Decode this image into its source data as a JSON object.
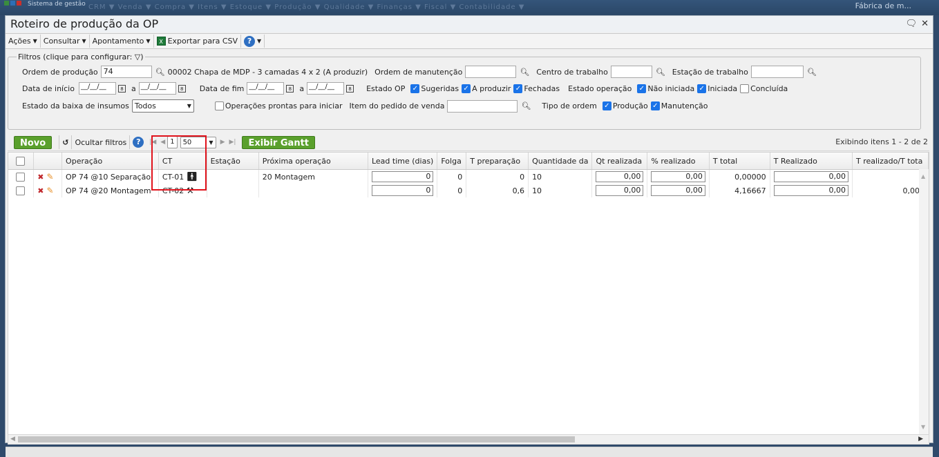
{
  "appbar": {
    "brand": "Sistema de gestão",
    "menu": "CRM ▼  Venda ▼  Compra ▼  Itens ▼  Estoque ▼  Produção ▼  Qualidade ▼  Finanças ▼  Fiscal ▼  Contabilidade ▼",
    "company": "Fábrica de m..."
  },
  "window": {
    "title": "Roteiro de produção da OP"
  },
  "toolbar": {
    "acoes": "Ações",
    "consultar": "Consultar",
    "apontamento": "Apontamento",
    "exportar": "Exportar para CSV",
    "help": "?"
  },
  "filters": {
    "legend": "Filtros (clique para configurar:",
    "ordem_producao_label": "Ordem de produção",
    "ordem_producao_value": "74",
    "ordem_producao_desc": "00002 Chapa de MDP - 3 camadas 4 x 2 (A produzir)",
    "ordem_manutencao_label": "Ordem de manutenção",
    "centro_trabalho_label": "Centro de trabalho",
    "estacao_trabalho_label": "Estação de trabalho",
    "data_inicio_label": "Data de início",
    "date_placeholder": "__/__/__",
    "a_label": "a",
    "data_fim_label": "Data de fim",
    "estado_op_label": "Estado OP",
    "sugeridas": "Sugeridas",
    "a_produzir": "A produzir",
    "fechadas": "Fechadas",
    "estado_operacao_label": "Estado operação",
    "nao_iniciada": "Não iniciada",
    "iniciada": "Iniciada",
    "concluida": "Concluída",
    "estado_baixa_label": "Estado da baixa de insumos",
    "estado_baixa_value": "Todos",
    "operacoes_prontas": "Operações prontas para iniciar",
    "item_pedido_label": "Item do pedido de venda",
    "tipo_ordem_label": "Tipo de ordem",
    "producao": "Produção",
    "manutencao": "Manutenção"
  },
  "gridbar": {
    "novo": "Novo",
    "ocultar_filtros": "Ocultar filtros",
    "help": "?",
    "page": "1",
    "page_size": "50",
    "exibir_gantt": "Exibir Gantt",
    "showing": "Exibindo itens 1 - 2 de 2"
  },
  "columns": {
    "operacao": "Operação",
    "ct": "CT",
    "estacao": "Estação",
    "proxima": "Próxima operação",
    "lead_time": "Lead time (dias)",
    "folga": "Folga",
    "t_preparacao": "T preparação",
    "quantidade": "Quantidade da",
    "qt_realizada": "Qt realizada",
    "pct_realizado": "% realizado",
    "t_total": "T total",
    "t_realizado": "T Realizado",
    "t_realizado_total": "T realizado/T tota"
  },
  "rows": [
    {
      "operacao": "OP 74 @10 Separação",
      "ct": "CT-01",
      "ct_icon": "person-icon",
      "estacao": "",
      "proxima": "20 Montagem",
      "lead_time": "0",
      "folga": "0",
      "t_preparacao": "0",
      "quantidade": "10",
      "qt_realizada": "0,00",
      "pct_realizado": "0,00",
      "t_total": "0,00000",
      "t_realizado": "0,00",
      "t_realizado_total": ""
    },
    {
      "operacao": "OP 74 @20 Montagem",
      "ct": "CT-02",
      "ct_icon": "machine-icon",
      "estacao": "",
      "proxima": "",
      "lead_time": "0",
      "folga": "0",
      "t_preparacao": "0,6",
      "quantidade": "10",
      "qt_realizada": "0,00",
      "pct_realizado": "0,00",
      "t_total": "4,16667",
      "t_realizado": "0,00",
      "t_realizado_total": "0,000"
    }
  ]
}
